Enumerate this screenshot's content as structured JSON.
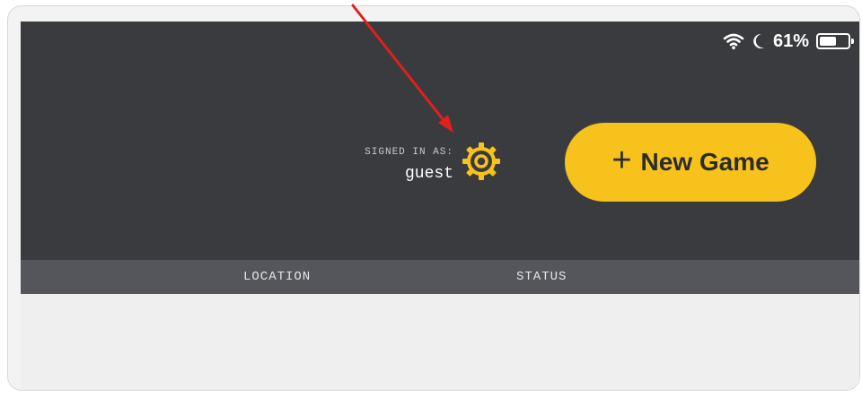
{
  "status_bar": {
    "battery_text": "61%",
    "battery_level": 0.61,
    "icons": [
      "wifi-icon",
      "moon-icon",
      "battery-icon"
    ]
  },
  "account": {
    "label": "SIGNED IN AS:",
    "username": "guest",
    "settings_icon": "gear-icon"
  },
  "actions": {
    "new_game_label": "New Game",
    "new_game_icon": "plus-icon"
  },
  "table": {
    "columns": [
      "LOCATION",
      "STATUS"
    ]
  },
  "colors": {
    "header_bg": "#3a3b3e",
    "column_header_bg": "#55565b",
    "accent": "#f7c21c",
    "annotation_arrow": "#e0201c"
  }
}
